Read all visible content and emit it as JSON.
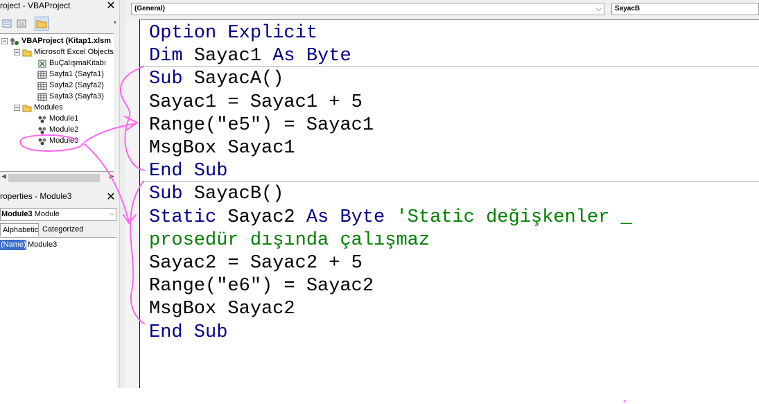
{
  "project_pane": {
    "title": "roject - VBAProject",
    "tree": [
      {
        "label": "VBAProject (Kitap1.xlsm",
        "kind": "project",
        "expander": "−"
      },
      {
        "label": "Microsoft Excel Objects",
        "kind": "folder",
        "expander": "−"
      },
      {
        "label": "BuÇalışmaKitabı",
        "kind": "workbook"
      },
      {
        "label": "Sayfa1 (Sayfa1)",
        "kind": "sheet"
      },
      {
        "label": "Sayfa2 (Sayfa2)",
        "kind": "sheet"
      },
      {
        "label": "Sayfa3 (Sayfa3)",
        "kind": "sheet"
      },
      {
        "label": "Modules",
        "kind": "folder",
        "expander": "−"
      },
      {
        "label": "Module1",
        "kind": "module"
      },
      {
        "label": "Module2",
        "kind": "module"
      },
      {
        "label": "Module3",
        "kind": "module"
      }
    ]
  },
  "properties_pane": {
    "title": "roperties - Module3",
    "object_name": "Module3",
    "object_type": "Module",
    "tabs": [
      "Alphabetic",
      "Categorized"
    ],
    "rows": [
      {
        "name": "(Name)",
        "value": "Module3"
      }
    ]
  },
  "code_window": {
    "object_dropdown": "(General)",
    "procedure_dropdown": "SayacB",
    "lines": [
      [
        {
          "t": "Option Explicit",
          "c": "kw"
        }
      ],
      [
        {
          "t": "Dim ",
          "c": "kw"
        },
        {
          "t": "Sayac1 ",
          "c": ""
        },
        {
          "t": "As Byte",
          "c": "kw"
        }
      ],
      [
        {
          "t": "Sub ",
          "c": "kw"
        },
        {
          "t": "SayacA()",
          "c": ""
        }
      ],
      [
        {
          "t": "Sayac1 = Sayac1 + 5",
          "c": ""
        }
      ],
      [
        {
          "t": "Range(\"e5\") = Sayac1",
          "c": ""
        }
      ],
      [
        {
          "t": "MsgBox Sayac1",
          "c": ""
        }
      ],
      [
        {
          "t": "End Sub",
          "c": "kw"
        }
      ],
      [
        {
          "t": "Sub ",
          "c": "kw"
        },
        {
          "t": "SayacB()",
          "c": ""
        }
      ],
      [
        {
          "t": "Static ",
          "c": "kw"
        },
        {
          "t": "Sayac2 ",
          "c": ""
        },
        {
          "t": "As Byte ",
          "c": "kw"
        },
        {
          "t": "'Static değişkenler _",
          "c": "cm"
        }
      ],
      [
        {
          "t": "prosedür dışında çalışmaz",
          "c": "cm"
        }
      ],
      [
        {
          "t": "Sayac2 = Sayac2 + 5",
          "c": ""
        }
      ],
      [
        {
          "t": "Range(\"e6\") = Sayac2",
          "c": ""
        }
      ],
      [
        {
          "t": "MsgBox Sayac2",
          "c": ""
        }
      ],
      [
        {
          "t": "End Sub",
          "c": "kw"
        }
      ]
    ]
  },
  "colors": {
    "keyword": "#00008b",
    "comment": "#008000",
    "annotation": "#ff66ee"
  }
}
